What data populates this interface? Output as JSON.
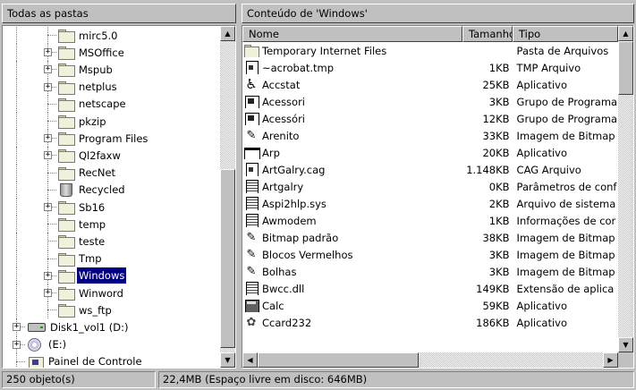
{
  "left_pane": {
    "title": "Todas as pastas",
    "tree": [
      {
        "label": "mirc5.0",
        "icon": "folder-icon",
        "expander": ""
      },
      {
        "label": "MSOffice",
        "icon": "folder-icon",
        "expander": "+"
      },
      {
        "label": "Mspub",
        "icon": "folder-icon",
        "expander": "+"
      },
      {
        "label": "netplus",
        "icon": "folder-icon",
        "expander": "+"
      },
      {
        "label": "netscape",
        "icon": "folder-icon",
        "expander": ""
      },
      {
        "label": "pkzip",
        "icon": "folder-icon",
        "expander": ""
      },
      {
        "label": "Program Files",
        "icon": "folder-icon",
        "expander": "+"
      },
      {
        "label": "Ql2faxw",
        "icon": "folder-icon",
        "expander": "+"
      },
      {
        "label": "RecNet",
        "icon": "folder-icon",
        "expander": ""
      },
      {
        "label": "Recycled",
        "icon": "recycle-bin-icon",
        "expander": ""
      },
      {
        "label": "Sb16",
        "icon": "folder-icon",
        "expander": "+"
      },
      {
        "label": "temp",
        "icon": "folder-icon",
        "expander": ""
      },
      {
        "label": "teste",
        "icon": "folder-icon",
        "expander": ""
      },
      {
        "label": "Tmp",
        "icon": "folder-icon",
        "expander": ""
      },
      {
        "label": "Windows",
        "icon": "open-folder-icon",
        "expander": "+",
        "selected": true
      },
      {
        "label": "Winword",
        "icon": "folder-icon",
        "expander": "+"
      },
      {
        "label": "ws_ftp",
        "icon": "folder-icon",
        "expander": ""
      },
      {
        "label": "Disk1_vol1 (D:)",
        "icon": "hard-drive-icon",
        "expander": "+"
      },
      {
        "label": "(E:)",
        "icon": "cd-drive-icon",
        "expander": "+"
      },
      {
        "label": "Painel de Controle",
        "icon": "control-panel-icon",
        "expander": ""
      }
    ]
  },
  "right_pane": {
    "title": "Conteúdo de 'Windows'",
    "columns": {
      "name": "Nome",
      "size": "Tamanho",
      "type": "Tipo"
    },
    "files": [
      {
        "name": "Temporary Internet Files",
        "size": "",
        "type": "Pasta de Arquivos",
        "icon": "folder"
      },
      {
        "name": "~acrobat.tmp",
        "size": "1KB",
        "type": "TMP Arquivo",
        "icon": "doc"
      },
      {
        "name": "Accstat",
        "size": "25KB",
        "type": "Aplicativo",
        "icon": "acc"
      },
      {
        "name": "Acessori",
        "size": "3KB",
        "type": "Grupo de Programa",
        "icon": "grp"
      },
      {
        "name": "Acessóri",
        "size": "12KB",
        "type": "Grupo de Programa",
        "icon": "grp"
      },
      {
        "name": "Arenito",
        "size": "33KB",
        "type": "Imagem de Bitmap",
        "icon": "bmp"
      },
      {
        "name": "Arp",
        "size": "20KB",
        "type": "Aplicativo",
        "icon": "app"
      },
      {
        "name": "ArtGalry.cag",
        "size": "1.148KB",
        "type": "CAG Arquivo",
        "icon": "doc"
      },
      {
        "name": "Artgalry",
        "size": "0KB",
        "type": "Parâmetros de conf",
        "icon": "txt"
      },
      {
        "name": "Aspi2hlp.sys",
        "size": "2KB",
        "type": "Arquivo de sistema",
        "icon": "txt"
      },
      {
        "name": "Awmodem",
        "size": "1KB",
        "type": "Informações de cor",
        "icon": "txt"
      },
      {
        "name": "Bitmap padrão",
        "size": "38KB",
        "type": "Imagem de Bitmap",
        "icon": "bmp"
      },
      {
        "name": "Blocos Vermelhos",
        "size": "3KB",
        "type": "Imagem de Bitmap",
        "icon": "bmp"
      },
      {
        "name": "Bolhas",
        "size": "3KB",
        "type": "Imagem de Bitmap",
        "icon": "bmp"
      },
      {
        "name": "Bwcc.dll",
        "size": "149KB",
        "type": "Extensão de aplica",
        "icon": "txt"
      },
      {
        "name": "Calc",
        "size": "59KB",
        "type": "Aplicativo",
        "icon": "calc"
      },
      {
        "name": "Ccard232",
        "size": "186KB",
        "type": "Aplicativo",
        "icon": "card"
      }
    ]
  },
  "status": {
    "objects": "250 objeto(s)",
    "disk": "22,4MB (Espaço livre em disco: 646MB)"
  }
}
